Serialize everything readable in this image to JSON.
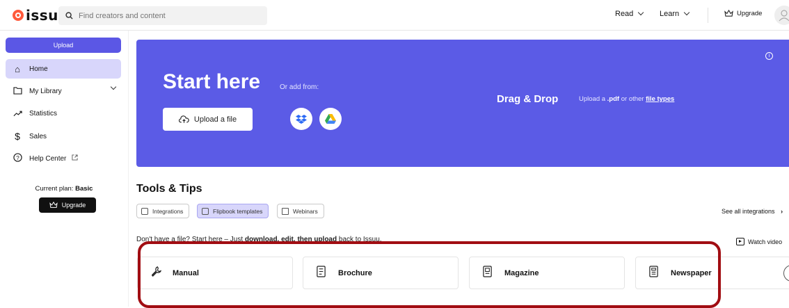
{
  "header": {
    "logo_text": "issuu",
    "search_placeholder": "Find creators and content",
    "nav": [
      {
        "label": "Read"
      },
      {
        "label": "Learn"
      }
    ],
    "upgrade_label": "Upgrade"
  },
  "sidebar": {
    "upload_label": "Upload",
    "items": [
      {
        "label": "Home",
        "icon": "home-icon",
        "active": true
      },
      {
        "label": "My Library",
        "icon": "folder-icon"
      },
      {
        "label": "Statistics",
        "icon": "trend-icon"
      },
      {
        "label": "Sales",
        "icon": "dollar-icon"
      },
      {
        "label": "Help Center",
        "icon": "help-icon"
      }
    ],
    "plan_prefix": "Current plan: ",
    "plan_name": "Basic",
    "plan_upgrade_label": "Upgrade"
  },
  "hero": {
    "title": "Start here",
    "or_add_from": "Or add from:",
    "upload_file_label": "Upload a file",
    "drag_drop_title": "Drag & Drop",
    "drag_drop_prefix": "Upload a ",
    "drag_drop_pdf": ".pdf",
    "drag_drop_middle": " or other ",
    "drag_drop_link": "file types",
    "accent_color": "#5b5be6"
  },
  "tools": {
    "title": "Tools & Tips",
    "chips": [
      {
        "label": "Integrations"
      },
      {
        "label": "Flipbook templates",
        "active": true
      },
      {
        "label": "Webinars"
      }
    ],
    "see_all_label": "See all integrations",
    "tip_prefix": "Don't have a file? Start here – Just ",
    "tip_bold": "download, edit, then upload",
    "tip_suffix": " back to Issuu.",
    "watch_video_label": "Watch video",
    "cards": [
      {
        "label": "Manual",
        "icon": "wrench-icon"
      },
      {
        "label": "Brochure",
        "icon": "document-icon"
      },
      {
        "label": "Magazine",
        "icon": "magazine-icon"
      },
      {
        "label": "Newspaper",
        "icon": "newspaper-icon"
      }
    ]
  }
}
